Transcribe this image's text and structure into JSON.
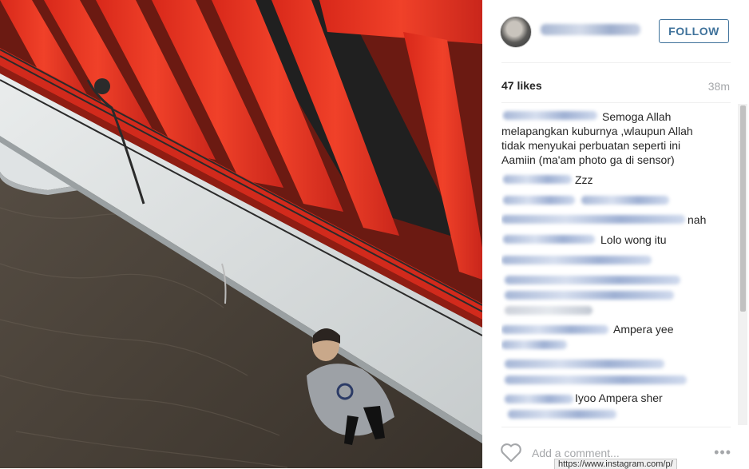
{
  "post": {
    "username_blurred": true,
    "follow_label": "FOLLOW",
    "likes_text": "47 likes",
    "time_text": "38m"
  },
  "comments": [
    {
      "user_blurred": true,
      "text": "Semoga Allah"
    },
    {
      "user_blurred": false,
      "text": "melapangkan kuburnya ,wlaupun Allah"
    },
    {
      "user_blurred": false,
      "text": "tidak menyukai perbuatan seperti ini"
    },
    {
      "user_blurred": false,
      "text": "Aamiin (ma'am photo ga di sensor)"
    },
    {
      "user_blurred": true,
      "text": "Zzz"
    },
    {
      "user_blurred": true,
      "text": ""
    },
    {
      "user_blurred": true,
      "text": "nah"
    },
    {
      "user_blurred": true,
      "text": "Lolo wong itu"
    },
    {
      "user_blurred": true,
      "text": ""
    },
    {
      "user_blurred": true,
      "text": ""
    },
    {
      "user_blurred": true,
      "text": "Ampera yee"
    },
    {
      "user_blurred": true,
      "text": ""
    },
    {
      "user_blurred": true,
      "text": "Iyoo Ampera sher"
    }
  ],
  "footer": {
    "add_comment_placeholder": "Add a comment...",
    "more_label": "•••"
  },
  "status_bar": {
    "url_text": "https://www.instagram.com/p/"
  },
  "colors": {
    "accent": "#3f729b",
    "bridge_red": "#e8321f",
    "water": "#4a4137"
  },
  "icons": {
    "like": "heart-outline-icon",
    "more": "ellipsis-icon"
  }
}
